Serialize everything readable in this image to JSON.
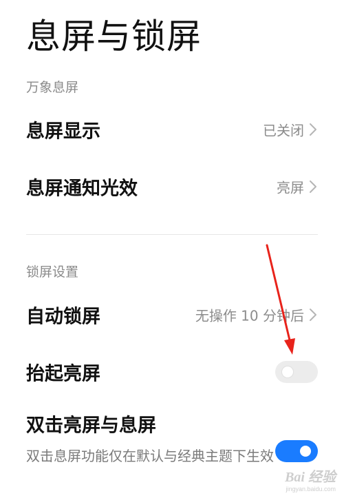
{
  "page": {
    "title": "息屏与锁屏"
  },
  "sections": {
    "aod": {
      "header": "万象息屏",
      "display": {
        "label": "息屏显示",
        "value": "已关闭"
      },
      "notification_light": {
        "label": "息屏通知光效",
        "value": "亮屏"
      }
    },
    "lock": {
      "header": "锁屏设置",
      "auto_lock": {
        "label": "自动锁屏",
        "value": "无操作 10 分钟后"
      },
      "raise_to_wake": {
        "label": "抬起亮屏",
        "enabled": false
      },
      "double_tap": {
        "label": "双击亮屏与息屏",
        "description": "双击息屏功能仅在默认与经典主题下生效",
        "enabled": true
      }
    }
  },
  "colors": {
    "accent": "#1a7cff",
    "annotation_arrow": "#e8231b",
    "secondary_text": "#8c8c8c"
  },
  "watermark": {
    "logo_text": "Bai 经验",
    "url": "jingyan.baidu.com"
  },
  "icons": {
    "chevron": "chevron-right-icon",
    "arrow": "red-arrow-annotation"
  }
}
